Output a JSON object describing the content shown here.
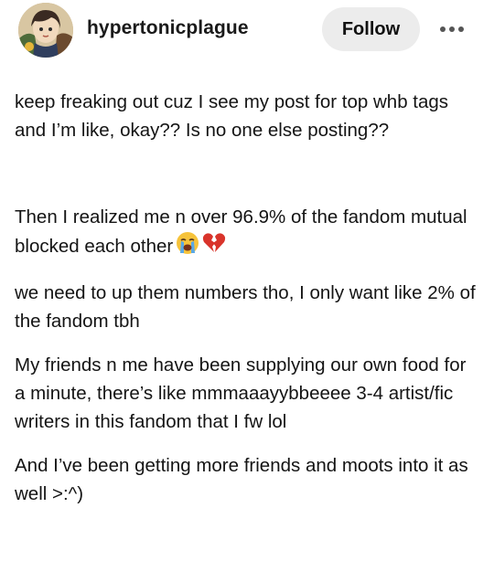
{
  "header": {
    "username": "hypertonicplague",
    "follow_label": "Follow",
    "avatar_icon": "anime-character-avatar-icon",
    "more_icon": "more-options-icon"
  },
  "post": {
    "paragraphs": [
      "keep freaking out cuz I see my post for top whb tags and I’m like, okay?? Is no one else posting??",
      "Then I realized me n over 96.9% of the fandom mutual blocked each other",
      "we need to up them numbers tho, I only want like 2% of the fandom tbh",
      "My friends n me have been supplying our own food for a minute, there’s like mmmaaayybbeeee 3-4 artist/fic writers in this fandom that I fw lol",
      "And I’ve been getting more friends and moots into it as well >:^)"
    ],
    "emojis": [
      "loudly-crying-face-icon",
      "broken-heart-icon"
    ]
  },
  "colors": {
    "text": "#141414",
    "follow_bg": "#ececec",
    "heart": "#d9342b",
    "emoji_face": "#f6c33b"
  }
}
